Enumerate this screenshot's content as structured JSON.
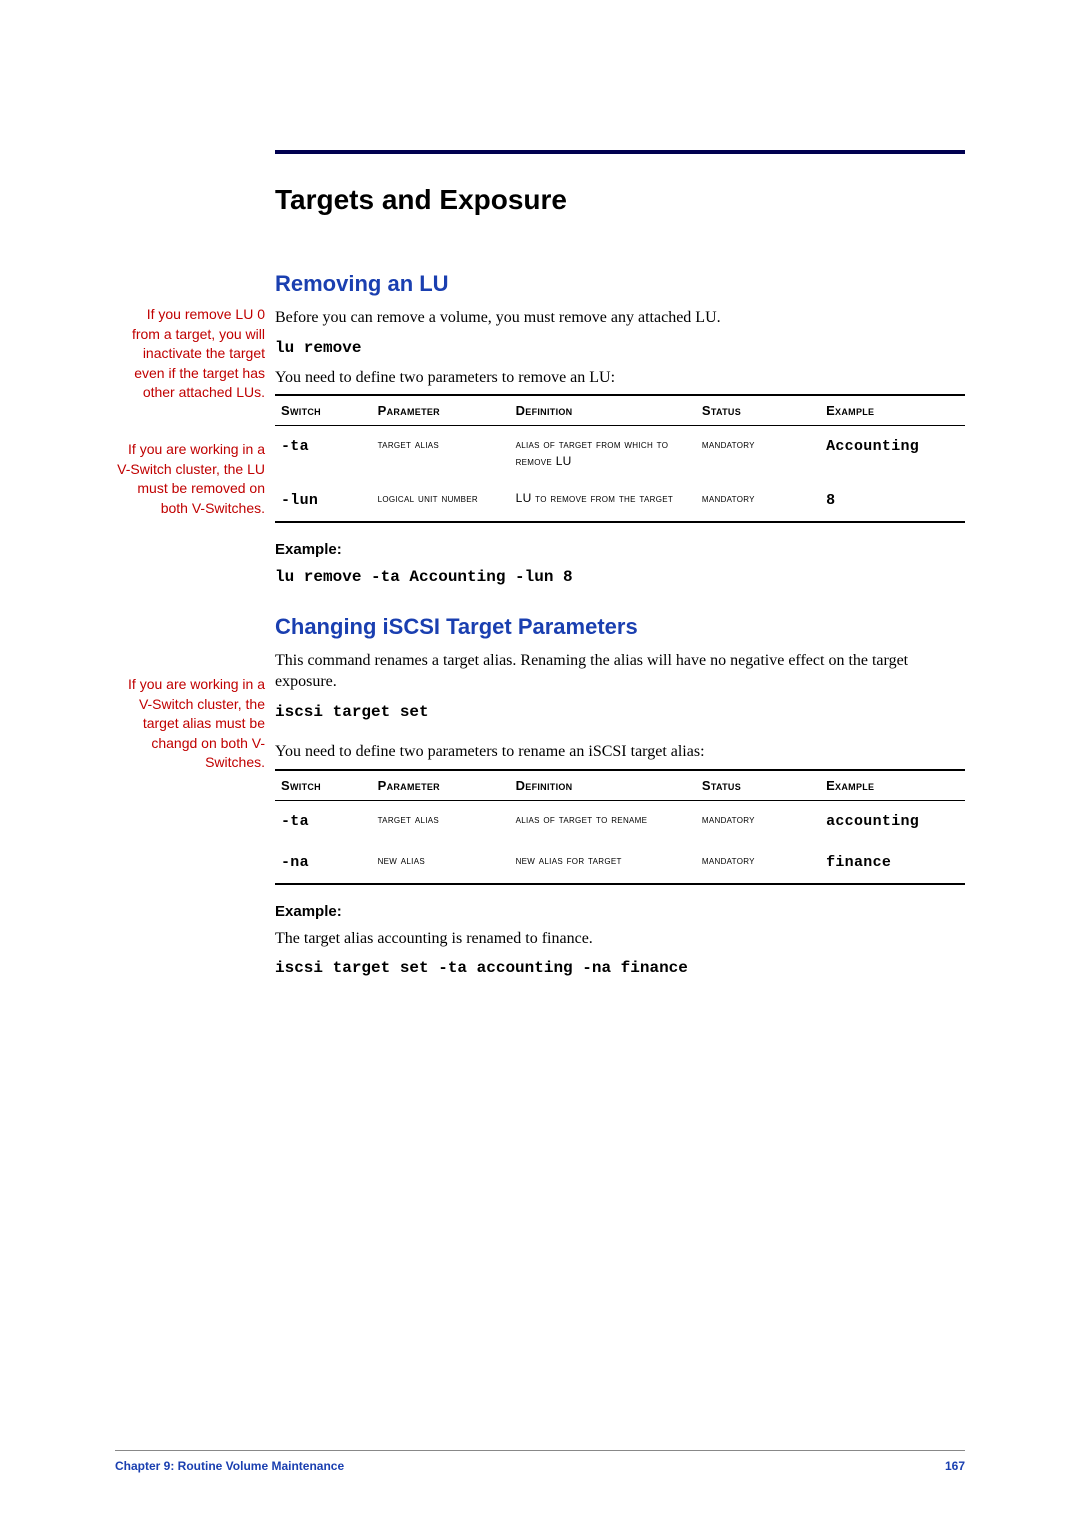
{
  "title": "Targets and Exposure",
  "section1": {
    "heading": "Removing an LU",
    "note": "If you remove LU 0 from a target, you will inactivate the target even if the target has other attached LUs.",
    "intro": "Before you can remove a volume, you must remove any attached LU.",
    "command": "lu remove",
    "desc": "You need to define two parameters to remove an LU:",
    "tableNote": "If you are working in a V-Switch cluster, the LU must be removed on both V-Switches.",
    "headers": {
      "switch": "Switch",
      "parameter": "Parameter",
      "definition": "Definition",
      "status": "Status",
      "example": "Example"
    },
    "rows": [
      {
        "switch": "-ta",
        "parameter": "target alias",
        "definition": "alias of target from which to remove LU",
        "status": "mandatory",
        "example": "Accounting"
      },
      {
        "switch": "-lun",
        "parameter": "logical unit number",
        "definition": "LU to remove from the target",
        "status": "mandatory",
        "example": "8"
      }
    ],
    "exampleLabel": "Example:",
    "exampleCmd": "lu remove -ta Accounting -lun 8"
  },
  "section2": {
    "heading": "Changing iSCSI Target Parameters",
    "note": "If you are working in a V-Switch cluster, the target alias must be changd on both V-Switches.",
    "intro": "This command renames a target alias.  Renaming the alias will have no negative effect on the target exposure.",
    "command": "iscsi target set",
    "desc": "You need to define two parameters to rename an iSCSI target alias:",
    "headers": {
      "switch": "Switch",
      "parameter": "Parameter",
      "definition": "Definition",
      "status": "Status",
      "example": "Example"
    },
    "rows": [
      {
        "switch": "-ta",
        "parameter": "target alias",
        "definition": "alias of target to rename",
        "status": "mandatory",
        "example": "accounting"
      },
      {
        "switch": "-na",
        "parameter": "new alias",
        "definition": "new alias for target",
        "status": "mandatory",
        "example": "finance"
      }
    ],
    "exampleLabel": "Example:",
    "exampleText": "The target alias accounting is renamed to finance.",
    "exampleCmd": "iscsi target set -ta accounting -na finance"
  },
  "footer": {
    "left": "Chapter 9:  Routine Volume Maintenance",
    "right": "167"
  }
}
